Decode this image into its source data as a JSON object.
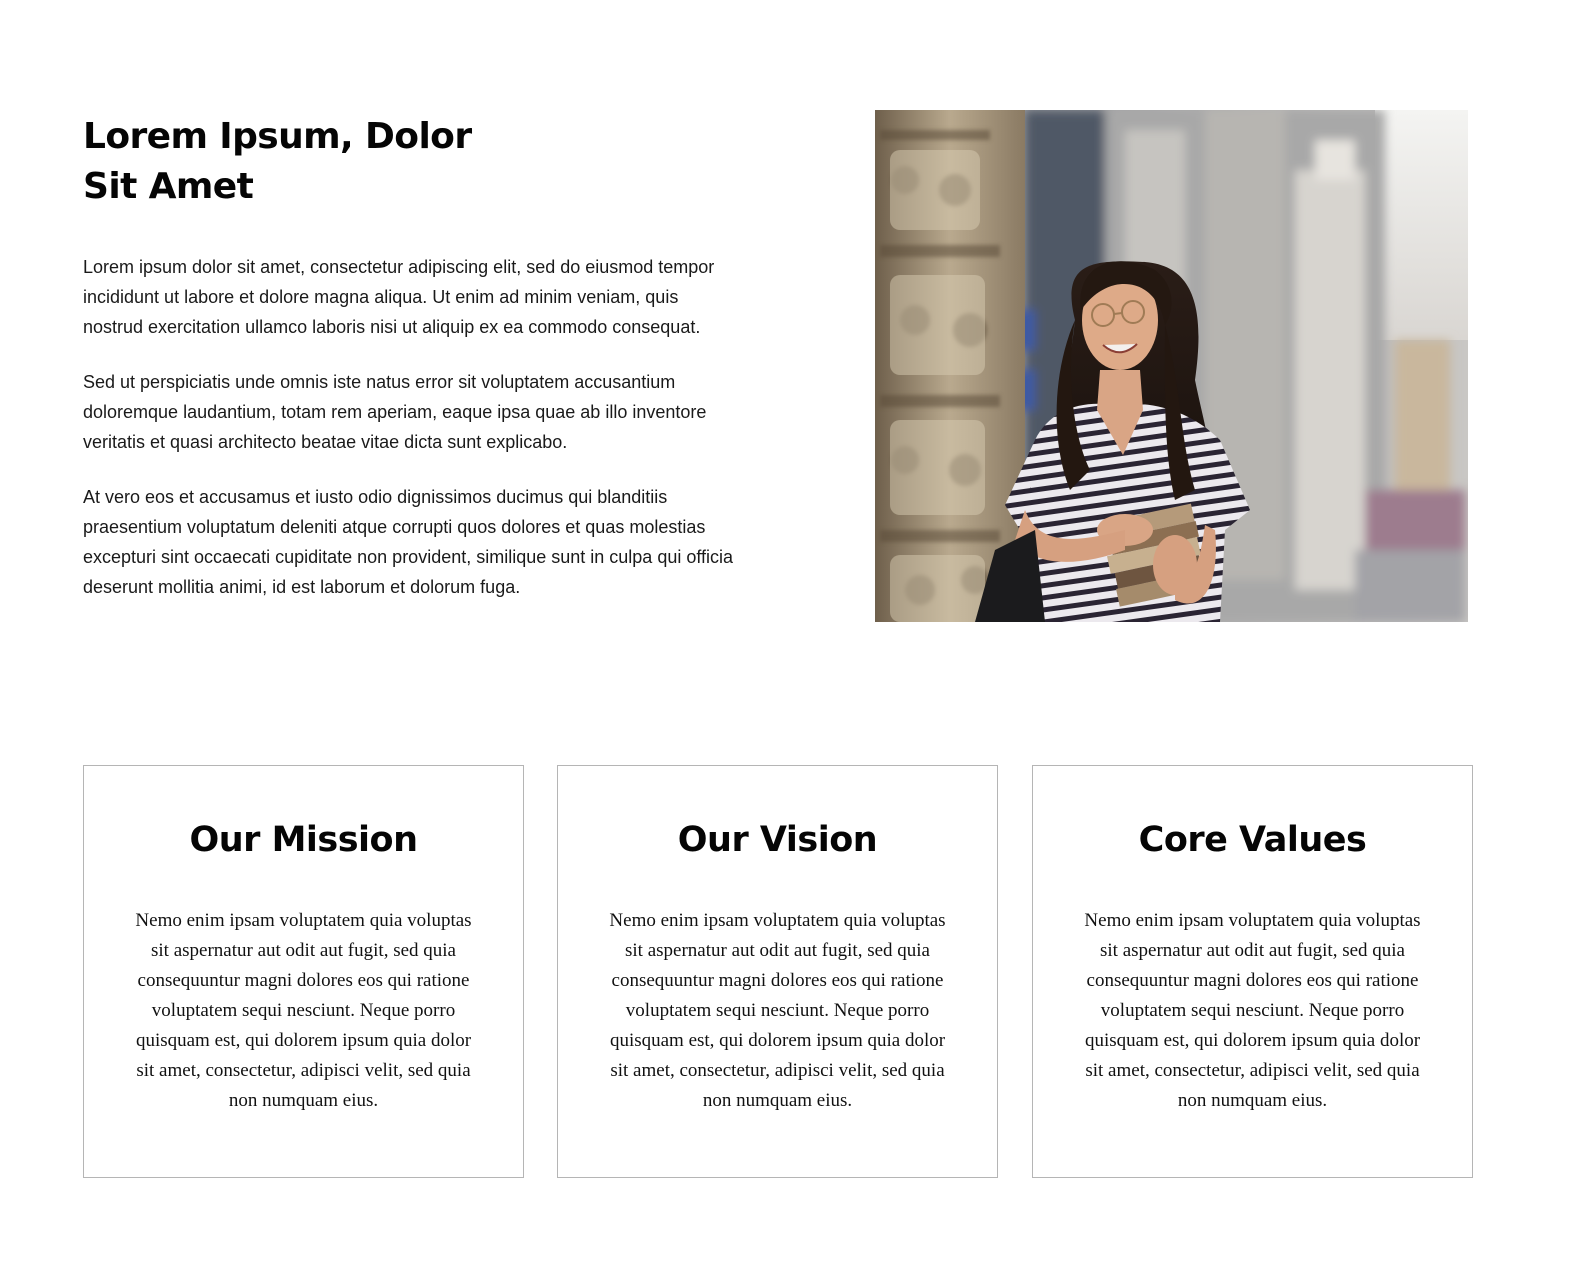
{
  "intro": {
    "title_line1": "Lorem Ipsum, Dolor",
    "title_line2": "Sit Amet",
    "paragraphs": [
      "Lorem ipsum dolor sit amet, consectetur adipiscing elit, sed do eiusmod tempor incididunt ut labore et dolore magna aliqua. Ut enim ad minim veniam, quis nostrud exercitation ullamco laboris nisi ut aliquip ex ea commodo consequat.",
      "Sed ut perspiciatis unde omnis iste natus error sit voluptatem accusantium doloremque laudantium, totam rem aperiam, eaque ipsa quae ab illo inventore veritatis et quasi architecto beatae vitae dicta sunt explicabo.",
      "At vero eos et accusamus et iusto odio dignissimos ducimus qui blanditiis praesentium voluptatum deleniti atque corrupti quos dolores et quas molestias excepturi sint occaecati cupiditate non provident, similique sunt in culpa qui officia deserunt mollitia animi, id est laborum et dolorum fuga."
    ]
  },
  "cards": [
    {
      "title": "Our Mission",
      "text": "Nemo enim ipsam voluptatem quia voluptas sit aspernatur aut odit aut fugit, sed quia consequuntur magni dolores eos qui ratione voluptatem sequi nesciunt. Neque porro quisquam est, qui dolorem ipsum quia dolor sit amet, consectetur, adipisci velit, sed quia non numquam eius."
    },
    {
      "title": "Our Vision",
      "text": "Nemo enim ipsam voluptatem quia voluptas sit aspernatur aut odit aut fugit, sed quia consequuntur magni dolores eos qui ratione voluptatem sequi nesciunt. Neque porro quisquam est, qui dolorem ipsum quia dolor sit amet, consectetur, adipisci velit, sed quia non numquam eius."
    },
    {
      "title": "Core Values",
      "text": "Nemo enim ipsam voluptatem quia voluptas sit aspernatur aut odit aut fugit, sed quia consequuntur magni dolores eos qui ratione voluptatem sequi nesciunt. Neque porro quisquam est, qui dolorem ipsum quia dolor sit amet, consectetur, adipisci velit, sed quia non numquam eius."
    }
  ],
  "colors": {
    "heading": "#050505",
    "body_text": "#1a1a1a",
    "card_border": "#b5b5b5",
    "background": "#ffffff"
  }
}
